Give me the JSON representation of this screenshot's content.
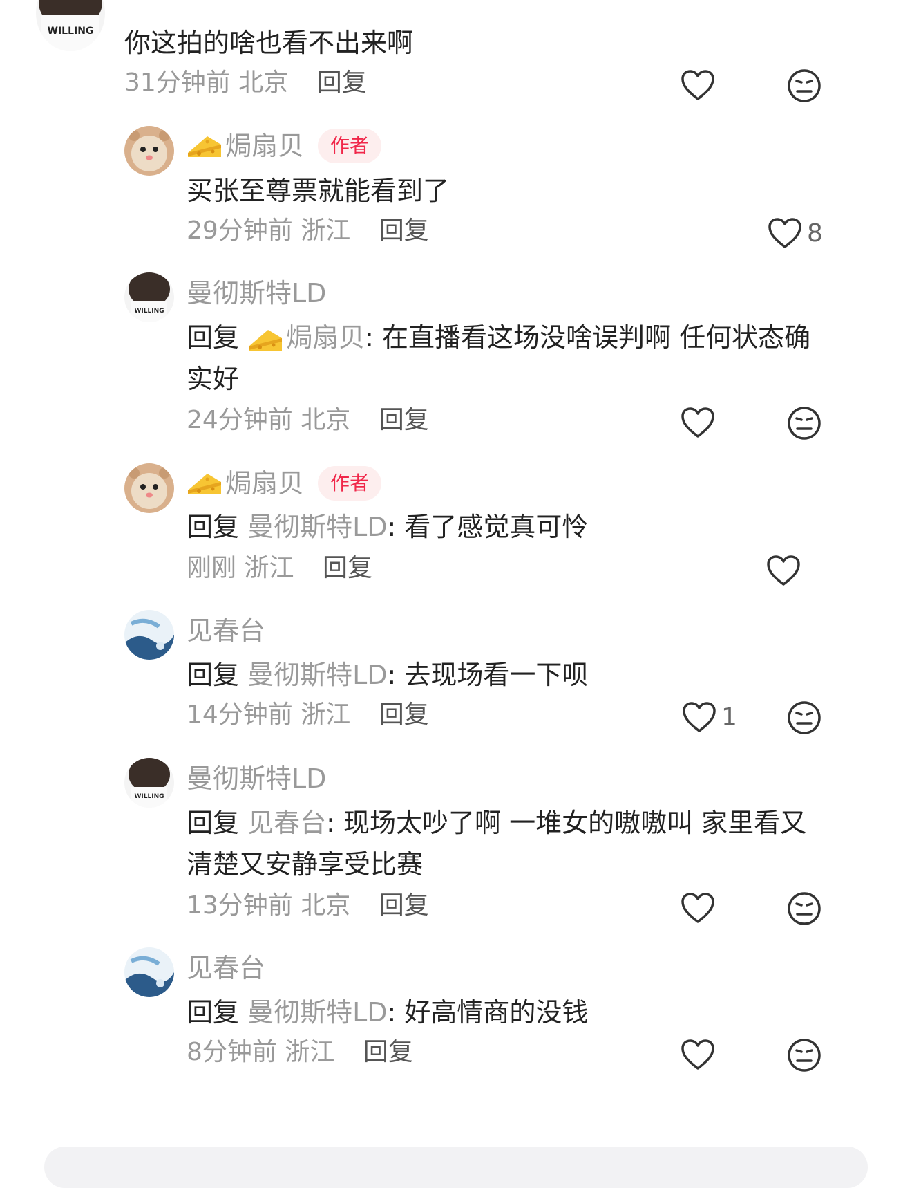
{
  "comments": [
    {
      "text": "你这拍的啥也看不出来啊",
      "time": "31分钟前",
      "location": "北京",
      "reply_label": "回复",
      "like_count": ""
    },
    {
      "name": "🧀焗扇贝",
      "badge": "作者",
      "text": "买张至尊票就能看到了",
      "time": "29分钟前",
      "location": "浙江",
      "reply_label": "回复",
      "like_count": "8"
    },
    {
      "name": "曼彻斯特LD",
      "reply_prefix": "回复",
      "mention": "🧀焗扇贝",
      "line1": ": 在直播看这场没啥误判啊 任何状态确",
      "line2": "实好",
      "time": "24分钟前",
      "location": "北京",
      "reply_label": "回复"
    },
    {
      "name": "🧀焗扇贝",
      "badge": "作者",
      "reply_prefix": "回复",
      "mention": "曼彻斯特LD",
      "text": ": 看了感觉真可怜",
      "time": "刚刚",
      "location": "浙江",
      "reply_label": "回复"
    },
    {
      "name": "见春台",
      "reply_prefix": "回复",
      "mention": "曼彻斯特LD",
      "text": ": 去现场看一下呗",
      "time": "14分钟前",
      "location": "浙江",
      "reply_label": "回复",
      "like_count": "1"
    },
    {
      "name": "曼彻斯特LD",
      "reply_prefix": "回复",
      "mention": "见春台",
      "line1": ": 现场太吵了啊 一堆女的嗷嗷叫 家里看又",
      "line2": "清楚又安静享受比赛",
      "time": "13分钟前",
      "location": "北京",
      "reply_label": "回复"
    },
    {
      "name": "见春台",
      "reply_prefix": "回复",
      "mention": "曼彻斯特LD",
      "text": ": 好高情商的没钱",
      "time": "8分钟前",
      "location": "浙江",
      "reply_label": "回复"
    }
  ],
  "names": {
    "scallop": "焗扇贝",
    "manchester": "曼彻斯特LD",
    "jianchuntai": "见春台"
  },
  "colors": {
    "author_badge": "#f0284a",
    "badge_bg": "#fdeeee",
    "meta_gray": "#999999"
  }
}
